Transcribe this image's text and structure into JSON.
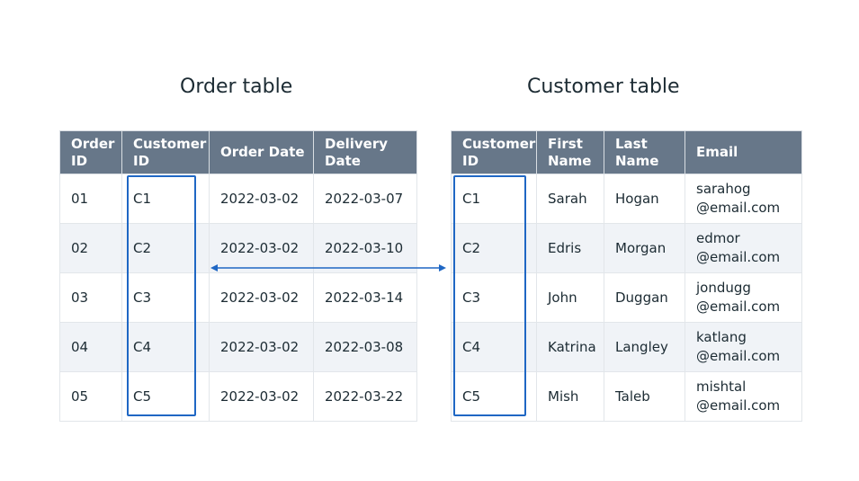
{
  "order_table": {
    "title": "Order table",
    "headers": [
      "Order\nID",
      "Customer\nID",
      "Order Date",
      "Delivery\nDate"
    ],
    "rows": [
      [
        "01",
        "C1",
        "2022-03-02",
        "2022-03-07"
      ],
      [
        "02",
        "C2",
        "2022-03-02",
        "2022-03-10"
      ],
      [
        "03",
        "C3",
        "2022-03-02",
        "2022-03-14"
      ],
      [
        "04",
        "C4",
        "2022-03-02",
        "2022-03-08"
      ],
      [
        "05",
        "C5",
        "2022-03-02",
        "2022-03-22"
      ]
    ]
  },
  "customer_table": {
    "title": "Customer table",
    "headers": [
      "Customer\nID",
      "First\nName",
      "Last\nName",
      "Email"
    ],
    "rows": [
      [
        "C1",
        "Sarah",
        "Hogan",
        "sarahog\n@email.com"
      ],
      [
        "C2",
        "Edris",
        "Morgan",
        "edmor\n@email.com"
      ],
      [
        "C3",
        "John",
        "Duggan",
        "jondugg\n@email.com"
      ],
      [
        "C4",
        "Katrina",
        "Langley",
        "katlang\n@email.com"
      ],
      [
        "C5",
        "Mish",
        "Taleb",
        "mishtal\n@email.com"
      ]
    ]
  },
  "colors": {
    "header_bg": "#677789",
    "highlight": "#1f67c4",
    "alt_row_bg": "#f0f3f7"
  }
}
